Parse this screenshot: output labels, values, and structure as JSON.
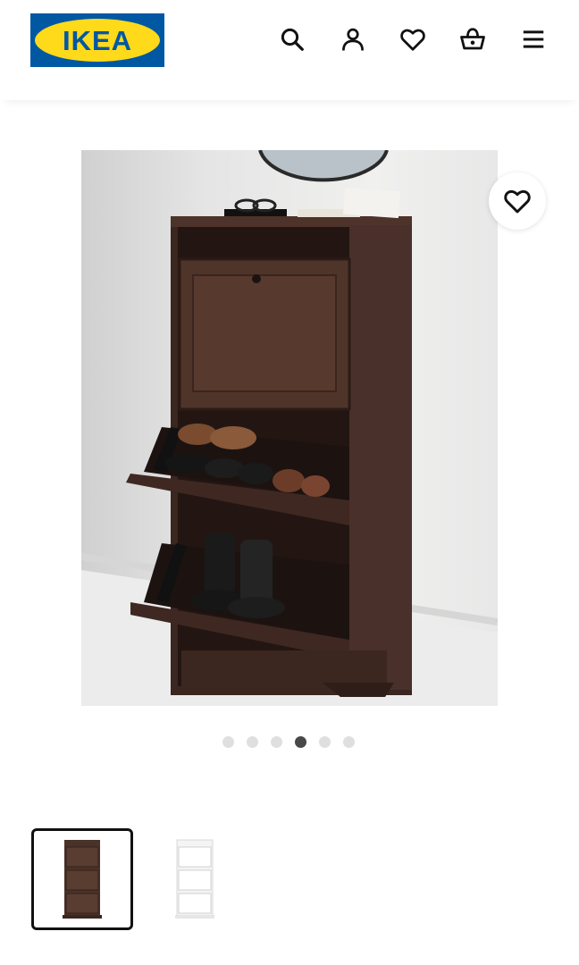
{
  "brand": {
    "logo_text": "IKEA",
    "logo_blue": "#0058a3",
    "logo_yellow": "#ffda1a"
  },
  "header": {
    "icons": [
      "search-icon",
      "account-icon",
      "favourites-icon",
      "shopping-bag-icon",
      "menu-icon"
    ]
  },
  "gallery": {
    "image_count": 6,
    "active_index": 3,
    "favourite_icon": "heart-icon"
  },
  "colors": {
    "dot_inactive": "#dfdfdf",
    "dot_active": "#484848",
    "selected_border": "#111111"
  },
  "variants": [
    {
      "name": "brown",
      "color": "#4a3229",
      "selected": true
    },
    {
      "name": "white",
      "color": "#f4f4f4",
      "selected": false
    }
  ]
}
